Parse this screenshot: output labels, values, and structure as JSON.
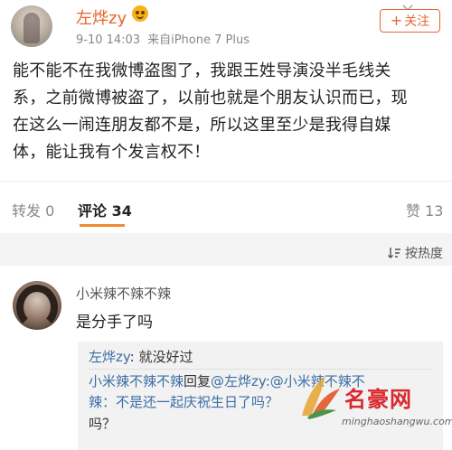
{
  "post": {
    "user_name": "左烨zy",
    "badge_icon": "emoji-face-icon",
    "date": "9-10 14:03",
    "source": "来自iPhone 7 Plus",
    "follow_plus": "+",
    "follow_label": "关注",
    "text_lines": [
      "能不能不在我微博盗图了，我跟王姓导演没半毛线关",
      "系，之前微博被盗了，以前也就是个朋友认识而已，现",
      "在这么一闹连朋友都不是，所以这里至少是我得自媒",
      "体，能让我有个发言权不！"
    ]
  },
  "tabs": {
    "repost": "转发 0",
    "comment": "评论 34",
    "like": "赞 13",
    "sort": "按热度"
  },
  "comment": {
    "author": "小米辣不辣不辣",
    "text": "是分手了吗",
    "replies": {
      "r1_name": "左烨zy",
      "r1_text": ": 就没好过",
      "r2_name": "小米辣不辣不辣",
      "r2_mid": "回复",
      "r2_at": "@左烨zy",
      "r2_tail": ":@小米辣不辣不",
      "r3_text": "辣：不是还一起庆祝生日了吗？",
      "r4_text": "吗？"
    }
  },
  "watermark": {
    "title": "名豪网",
    "url": "minghaoshangwu.com"
  },
  "colors": {
    "accent": "#e8652e",
    "link": "#3b6ea5",
    "tab_underline": "#f28a2e"
  }
}
